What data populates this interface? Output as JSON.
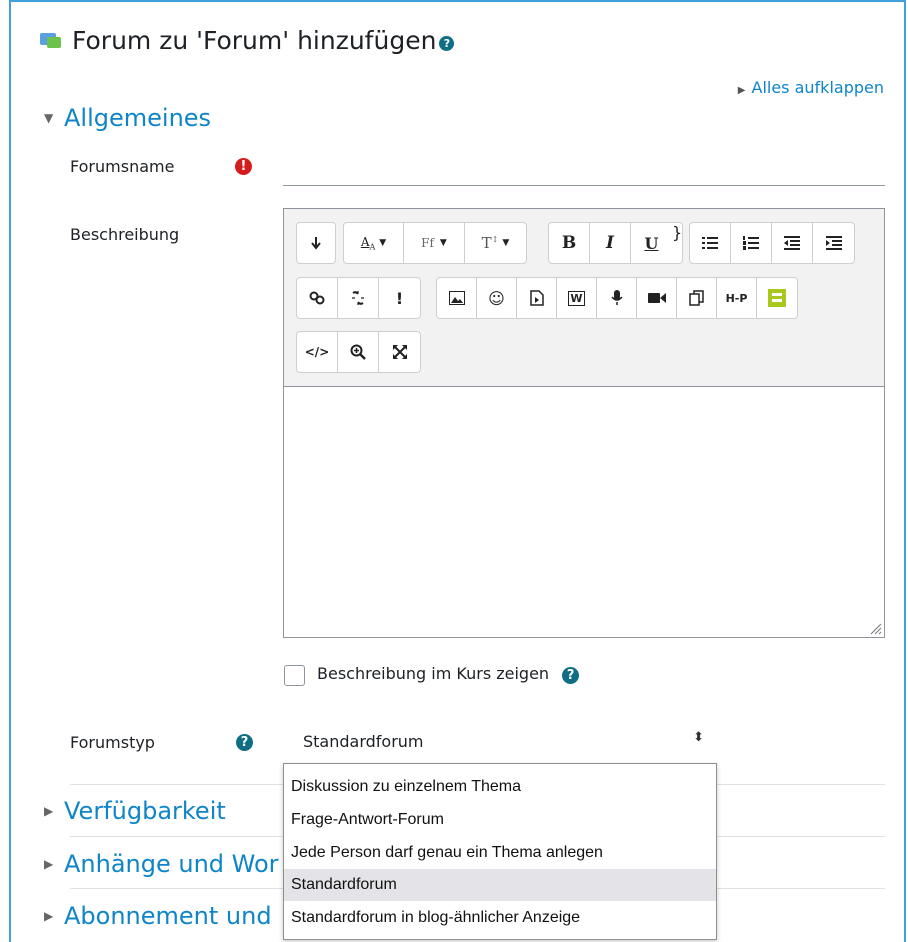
{
  "page": {
    "title": "Forum zu 'Forum' hinzufügen",
    "expand_all": "Alles aufklappen"
  },
  "sections": {
    "general": "Allgemeines",
    "availability": "Verfügbarkeit",
    "attachments": "Anhänge und Wor",
    "subscription": "Abonnement und"
  },
  "form": {
    "forum_name_label": "Forumsname",
    "forum_name_value": "",
    "description_label": "Beschreibung",
    "show_description_label": "Beschreibung im Kurs zeigen",
    "show_description_checked": false,
    "forum_type_label": "Forumstyp",
    "forum_type_value": "Standardforum"
  },
  "editor": {
    "toolbar_row1": [
      "show-more",
      "font-color",
      "font-family",
      "font-size",
      "bold",
      "italic",
      "underline",
      "unordered-list",
      "ordered-list",
      "outdent",
      "indent"
    ],
    "toolbar_row2": [
      "link",
      "unlink",
      "emoji-picker",
      "image",
      "emoticon",
      "media",
      "word-import",
      "record-audio",
      "record-video",
      "manage-files",
      "h5p",
      "generico"
    ],
    "toolbar_row3": [
      "html",
      "accessibility-checker",
      "fullscreen"
    ],
    "labels": {
      "bold": "B",
      "italic": "I",
      "underline": "U",
      "h5p": "H-P"
    }
  },
  "dropdown": {
    "options": [
      "Diskussion zu einzelnem Thema",
      "Frage-Antwort-Forum",
      "Jede Person darf genau ein Thema anlegen",
      "Standardforum",
      "Standardforum in blog-ähnlicher Anzeige"
    ],
    "selected_index": 3
  },
  "colors": {
    "link": "#0f85c8",
    "help_icon": "#0f6e84",
    "required_icon": "#d41e1e",
    "frame_border": "#41a0d8"
  }
}
